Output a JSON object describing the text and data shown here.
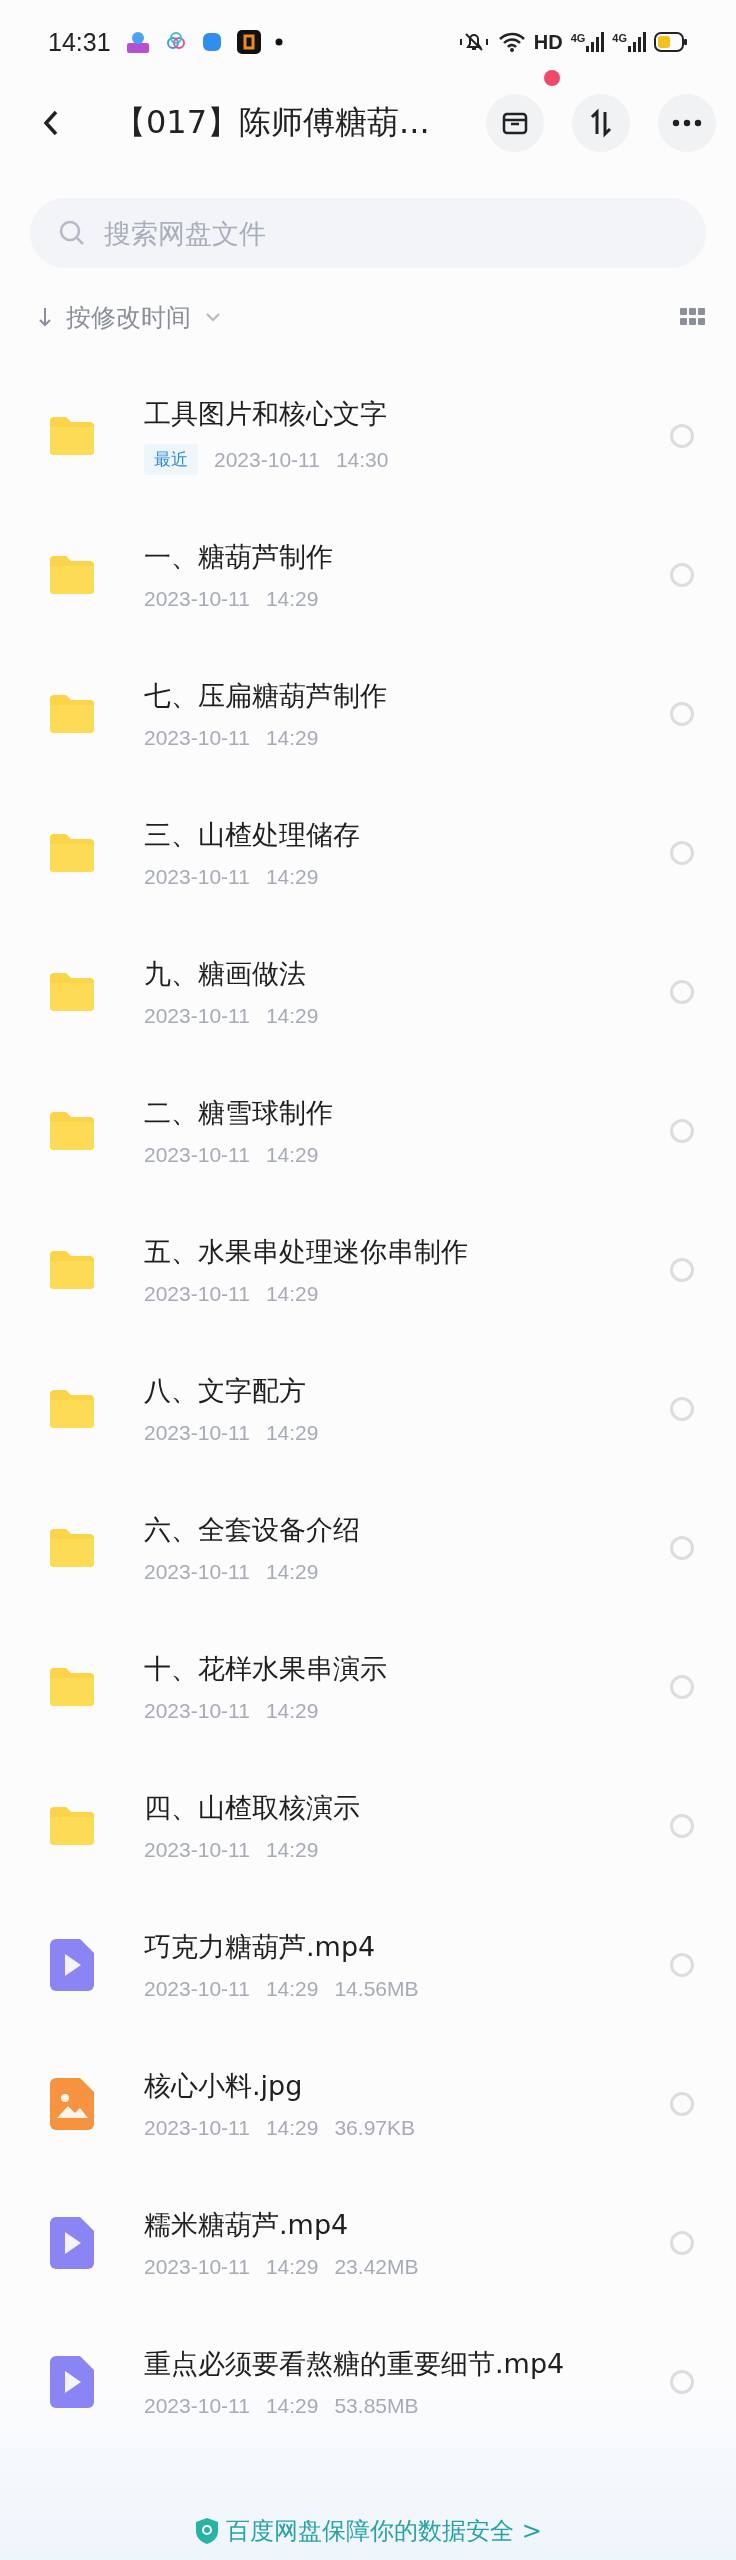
{
  "status_bar": {
    "time": "14:31",
    "network": "HD",
    "signal_labels": [
      "4G",
      "4G"
    ]
  },
  "header": {
    "title": "【017】陈师傅糖葫...",
    "notification_dot": true
  },
  "search": {
    "placeholder": "搜索网盘文件"
  },
  "sort": {
    "label": "按修改时间"
  },
  "files": [
    {
      "kind": "folder",
      "name": "工具图片和核心文字",
      "badge": "最近",
      "date": "2023-10-11",
      "time": "14:30",
      "selected": false
    },
    {
      "kind": "folder",
      "name": "一、糖葫芦制作",
      "date": "2023-10-11",
      "time": "14:29",
      "selected": false
    },
    {
      "kind": "folder",
      "name": "七、压扁糖葫芦制作",
      "date": "2023-10-11",
      "time": "14:29",
      "selected": false
    },
    {
      "kind": "folder",
      "name": "三、山楂处理储存",
      "date": "2023-10-11",
      "time": "14:29",
      "selected": false
    },
    {
      "kind": "folder",
      "name": "九、糖画做法",
      "date": "2023-10-11",
      "time": "14:29",
      "selected": false
    },
    {
      "kind": "folder",
      "name": "二、糖雪球制作",
      "date": "2023-10-11",
      "time": "14:29",
      "selected": false
    },
    {
      "kind": "folder",
      "name": "五、水果串处理迷你串制作",
      "date": "2023-10-11",
      "time": "14:29",
      "selected": false
    },
    {
      "kind": "folder",
      "name": "八、文字配方",
      "date": "2023-10-11",
      "time": "14:29",
      "selected": false
    },
    {
      "kind": "folder",
      "name": "六、全套设备介绍",
      "date": "2023-10-11",
      "time": "14:29",
      "selected": false
    },
    {
      "kind": "folder",
      "name": "十、花样水果串演示",
      "date": "2023-10-11",
      "time": "14:29",
      "selected": false
    },
    {
      "kind": "folder",
      "name": "四、山楂取核演示",
      "date": "2023-10-11",
      "time": "14:29",
      "selected": false
    },
    {
      "kind": "video",
      "name": "巧克力糖葫芦.mp4",
      "date": "2023-10-11",
      "time": "14:29",
      "size": "14.56MB",
      "selected": false
    },
    {
      "kind": "image",
      "name": "核心小料.jpg",
      "date": "2023-10-11",
      "time": "14:29",
      "size": "36.97KB",
      "selected": false
    },
    {
      "kind": "video",
      "name": "糯米糖葫芦.mp4",
      "date": "2023-10-11",
      "time": "14:29",
      "size": "23.42MB",
      "selected": false
    },
    {
      "kind": "video",
      "name": "重点必须要看熬糖的重要细节.mp4",
      "date": "2023-10-11",
      "time": "14:29",
      "size": "53.85MB",
      "selected": false
    }
  ],
  "footer": {
    "text": "百度网盘保障你的数据安全 >"
  }
}
